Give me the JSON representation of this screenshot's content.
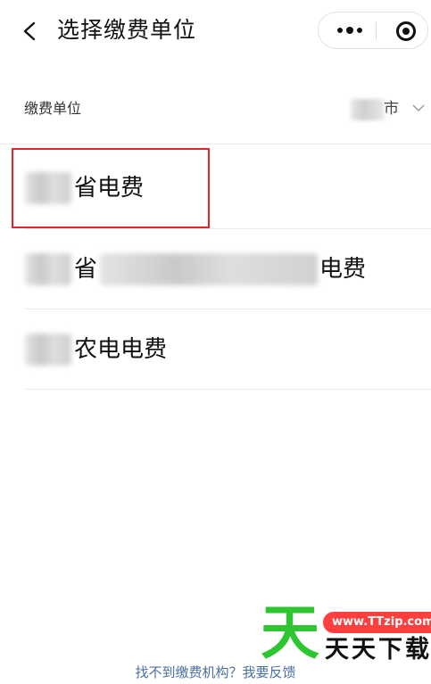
{
  "nav": {
    "title": "选择缴费单位",
    "back_icon": "chevron-left-icon",
    "more_icon": "more-dots-icon",
    "close_icon": "target-icon"
  },
  "payee": {
    "label": "缴费单位",
    "city_suffix": "市"
  },
  "items": [
    {
      "label": "省电费"
    },
    {
      "label_left": "省",
      "label_right": "电费"
    },
    {
      "label": "农电电费"
    }
  ],
  "colors": {
    "highlight": "#e0262a",
    "link": "#4a6fa5",
    "watermark_green": "#2ec630",
    "watermark_red": "#ff3e3e"
  },
  "footer": {
    "feedback": "找不到缴费机构？我要反馈"
  },
  "watermark": {
    "big": "天",
    "url": "www.TTzip.com",
    "site": "天天下载"
  }
}
